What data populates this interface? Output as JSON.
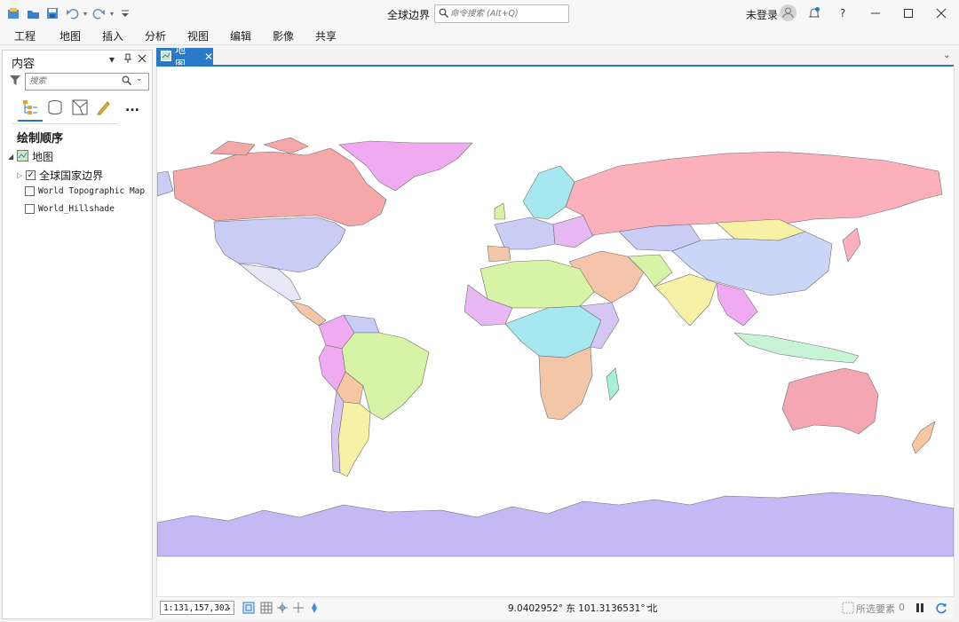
{
  "title_bar": {
    "document_title": "全球边界",
    "command_search_placeholder": "命令搜索 (Alt+Q)",
    "sign_in_label": "未登录",
    "icons": [
      "new-project-icon",
      "open-project-icon",
      "save-project-icon",
      "undo-icon",
      "redo-icon",
      "customize-qat-icon",
      "notification-icon",
      "help-icon",
      "minimize-icon",
      "maximize-icon",
      "close-icon"
    ]
  },
  "ribbon_tabs": [
    "工程",
    "地图",
    "插入",
    "分析",
    "视图",
    "编辑",
    "影像",
    "共享"
  ],
  "contents_pane": {
    "title": "内容",
    "search_placeholder": "搜索",
    "more_label": "...",
    "draw_order_heading": "绘制顺序",
    "map_node": "地图",
    "layers": [
      {
        "name": "全球国家边界",
        "checked": true
      },
      {
        "name": "World Topographic Map",
        "checked": false
      },
      {
        "name": "World_Hillshade",
        "checked": false
      }
    ]
  },
  "map_view": {
    "tab_label": "地图",
    "land_outline_color": "#6e6e6e",
    "ocean_color": "#ffffff",
    "antarctica_color": "#c4b8f5"
  },
  "status_bar": {
    "scale": "1:131,157,302",
    "coordinates": "9.0402952° 东 101.3136531° 北",
    "selected_features_label": "所选要素",
    "selected_count": "0"
  }
}
